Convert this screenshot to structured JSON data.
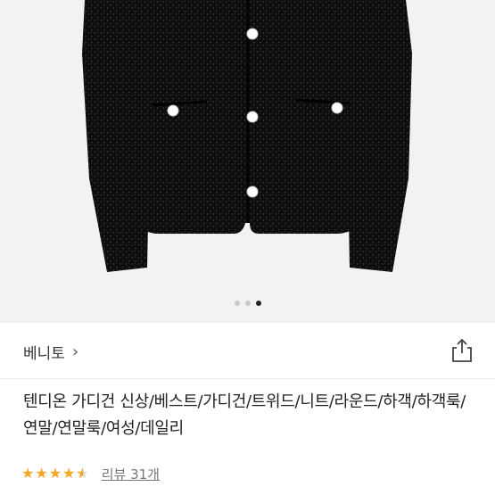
{
  "product_image": {
    "page_indicator": {
      "total": 3,
      "active_index": 2
    }
  },
  "brand": {
    "name": "베니토",
    "chevron": "chevron-right-icon"
  },
  "share_icon": "share-icon",
  "product": {
    "title": "텐디온 가디건 신상/베스트/가디건/트위드/니트/라운드/하객/하객룩/연말/연말룩/여성/데일리"
  },
  "rating": {
    "value": 4.5,
    "max": 5,
    "review_label": "리뷰 31개"
  },
  "colors": {
    "star": "#f5a623",
    "background": "#f2f2f2"
  }
}
